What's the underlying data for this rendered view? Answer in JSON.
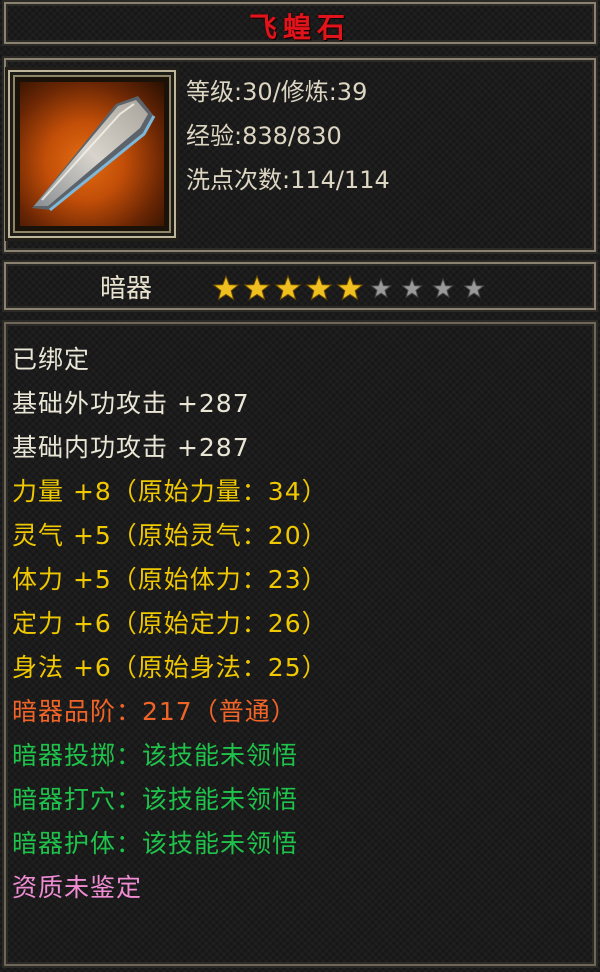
{
  "item": {
    "name": "飞蝗石",
    "image_icon": "flying-stone-dart-icon"
  },
  "header_stats": [
    "等级:30/修炼:39",
    "经验:838/830",
    "洗点次数:114/114"
  ],
  "type_row": {
    "label": "暗器",
    "stars_total": 9,
    "stars_filled": 5,
    "star_filled_color": "#f0c020",
    "star_empty_color": "#9a9a9a"
  },
  "attributes": [
    {
      "text": "已绑定",
      "color": "white"
    },
    {
      "text": "基础外功攻击 +287",
      "color": "white"
    },
    {
      "text": "基础内功攻击 +287",
      "color": "white"
    },
    {
      "text": "力量 +8（原始力量：34）",
      "color": "yellow"
    },
    {
      "text": "灵气 +5（原始灵气：20）",
      "color": "yellow"
    },
    {
      "text": "体力 +5（原始体力：23）",
      "color": "yellow"
    },
    {
      "text": "定力 +6（原始定力：26）",
      "color": "yellow"
    },
    {
      "text": "身法 +6（原始身法：25）",
      "color": "yellow"
    },
    {
      "text": "暗器品阶：217（普通）",
      "color": "orange"
    },
    {
      "text": "暗器投掷：该技能未领悟",
      "color": "green"
    },
    {
      "text": "暗器打穴：该技能未领悟",
      "color": "green"
    },
    {
      "text": "暗器护体：该技能未领悟",
      "color": "green"
    },
    {
      "text": "资质未鉴定",
      "color": "pink"
    }
  ],
  "colors": {
    "title": "#e0141a",
    "white": "#eae6d6",
    "yellow": "#f0c800",
    "orange": "#f06428",
    "green": "#1fc24a",
    "pink": "#f08cd4"
  }
}
